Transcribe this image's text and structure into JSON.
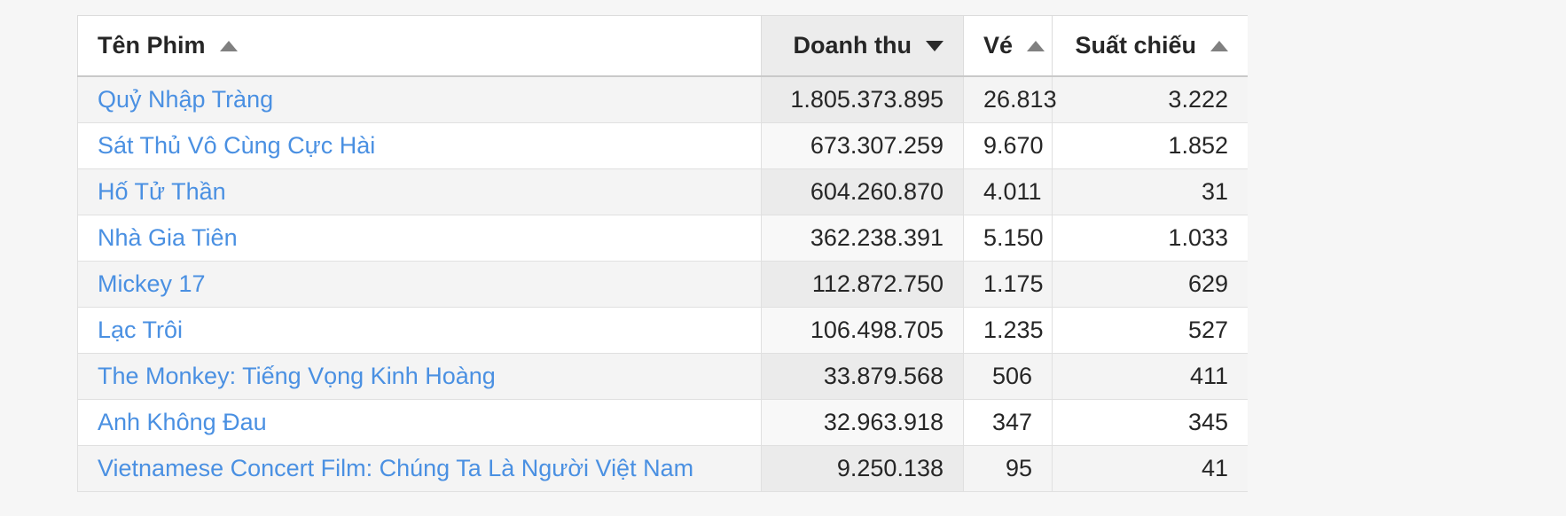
{
  "table": {
    "columns": [
      {
        "key": "name",
        "label": "Tên Phim",
        "sort": "asc",
        "active": false,
        "align": "left"
      },
      {
        "key": "rev",
        "label": "Doanh thu",
        "sort": "desc",
        "active": true,
        "align": "right"
      },
      {
        "key": "tick",
        "label": "Vé",
        "sort": "asc",
        "active": false,
        "align": "right"
      },
      {
        "key": "show",
        "label": "Suất chiếu",
        "sort": "asc",
        "active": false,
        "align": "right"
      }
    ],
    "rows": [
      {
        "name": "Quỷ Nhập Tràng",
        "rev": "1.805.373.895",
        "tick": "26.813",
        "show": "3.222"
      },
      {
        "name": "Sát Thủ Vô Cùng Cực Hài",
        "rev": "673.307.259",
        "tick": "9.670",
        "show": "1.852"
      },
      {
        "name": "Hố Tử Thần",
        "rev": "604.260.870",
        "tick": "4.011",
        "show": "31"
      },
      {
        "name": "Nhà Gia Tiên",
        "rev": "362.238.391",
        "tick": "5.150",
        "show": "1.033"
      },
      {
        "name": "Mickey 17",
        "rev": "112.872.750",
        "tick": "1.175",
        "show": "629"
      },
      {
        "name": "Lạc Trôi",
        "rev": "106.498.705",
        "tick": "1.235",
        "show": "527"
      },
      {
        "name": "The Monkey: Tiếng Vọng Kinh Hoàng",
        "rev": "33.879.568",
        "tick": "506",
        "show": "411"
      },
      {
        "name": "Anh Không Đau",
        "rev": "32.963.918",
        "tick": "347",
        "show": "345"
      },
      {
        "name": "Vietnamese Concert Film: Chúng Ta Là Người Việt Nam",
        "rev": "9.250.138",
        "tick": "95",
        "show": "41"
      }
    ]
  },
  "colors": {
    "link": "#4a90e2",
    "sorted_header_bg": "#ececec",
    "row_stripe": "#f4f4f4",
    "page_bg": "#f6f6f6",
    "border": "#e0e0e0"
  }
}
